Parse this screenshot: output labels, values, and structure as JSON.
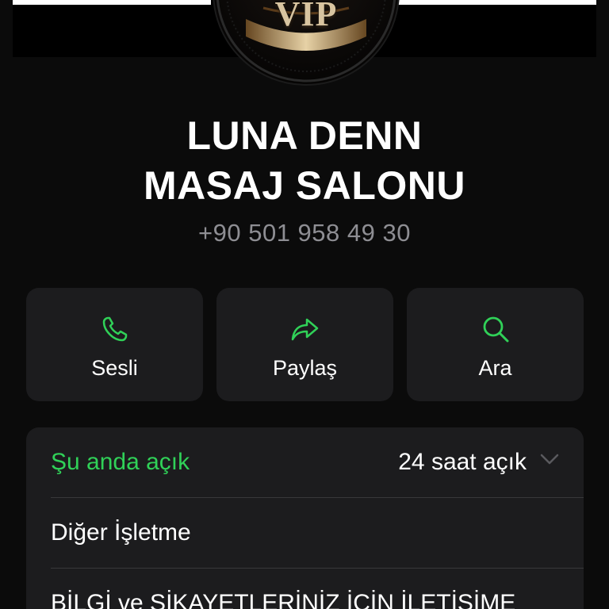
{
  "logo": {
    "text": "VIP"
  },
  "business": {
    "name_line1": "LUNA DENN",
    "name_line2": "MASAJ SALONU",
    "phone": "+90 501 958 49 30"
  },
  "actions": [
    {
      "label": "Sesli",
      "icon": "phone-icon"
    },
    {
      "label": "Paylaş",
      "icon": "share-arrow-icon"
    },
    {
      "label": "Ara",
      "icon": "search-icon"
    }
  ],
  "info": {
    "status": "Şu anda açık",
    "hours": "24 saat açık",
    "category": "Diğer İşletme",
    "description": "BİLGİ ve ŞİKAYETLERİNİZ İÇİN İLETİŞİME"
  },
  "colors": {
    "background": "#0b0b0b",
    "card": "#1c1c1e",
    "accent_green": "#30d158",
    "secondary_text": "#8e8e93"
  }
}
